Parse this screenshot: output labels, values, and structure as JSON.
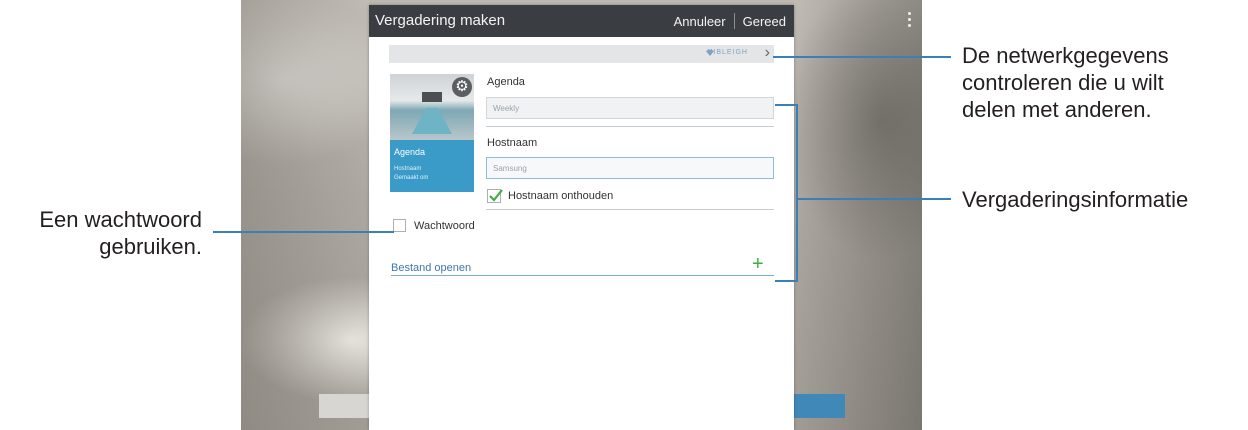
{
  "dialog": {
    "title": "Vergadering maken",
    "cancel": "Annuleer",
    "done": "Gereed",
    "network_text": "HIBLEIGH"
  },
  "card": {
    "title": "Agenda",
    "line1": "Hostnaam",
    "line2": "Gemaakt om"
  },
  "form": {
    "agenda_label": "Agenda",
    "agenda_value": "Weekly",
    "host_label": "Hostnaam",
    "host_value": "Samsung",
    "remember_label": "Hostnaam onthouden",
    "remember_checked": true,
    "password_label": "Wachtwoord",
    "password_checked": false,
    "open_file": "Bestand openen"
  },
  "annotations": {
    "network_line1": "De netwerkgegevens",
    "network_line2": "controleren die u wilt",
    "network_line3": "delen met anderen.",
    "meeting_info": "Vergaderingsinformatie",
    "password_line1": "Een wachtwoord",
    "password_line2": "gebruiken."
  },
  "colors": {
    "accent": "#3a7fb5",
    "header": "#3a3d42",
    "card": "#3a9bc8",
    "check": "#3fae3f"
  }
}
